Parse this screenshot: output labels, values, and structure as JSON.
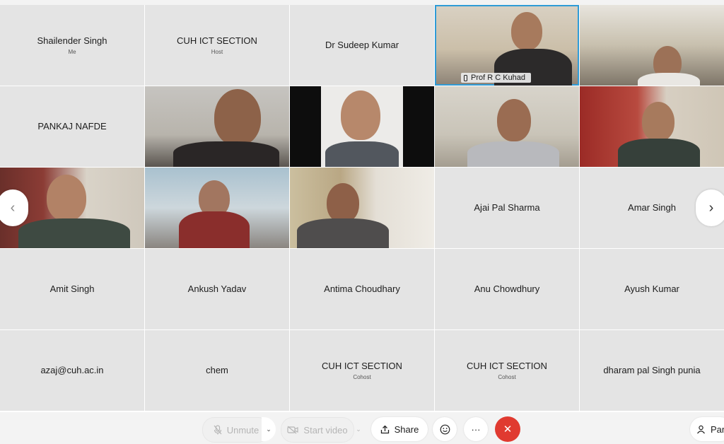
{
  "tiles": [
    {
      "name": "Shailender Singh",
      "role": "Me",
      "type": "name"
    },
    {
      "name": "CUH ICT SECTION",
      "role": "Host",
      "type": "name"
    },
    {
      "name": "Dr Sudeep Kumar",
      "role": "",
      "type": "name"
    },
    {
      "name": "Prof R C Kuhad",
      "role": "",
      "type": "video",
      "speaking": true
    },
    {
      "name": "",
      "role": "",
      "type": "video"
    },
    {
      "name": "PANKAJ NAFDE",
      "role": "",
      "type": "name"
    },
    {
      "name": "",
      "role": "",
      "type": "video"
    },
    {
      "name": "",
      "role": "",
      "type": "video"
    },
    {
      "name": "",
      "role": "",
      "type": "video"
    },
    {
      "name": "",
      "role": "",
      "type": "video"
    },
    {
      "name": "",
      "role": "",
      "type": "video"
    },
    {
      "name": "",
      "role": "",
      "type": "video"
    },
    {
      "name": "",
      "role": "",
      "type": "video"
    },
    {
      "name": "Ajai Pal Sharma",
      "role": "",
      "type": "name"
    },
    {
      "name": "Amar Singh",
      "role": "",
      "type": "name"
    },
    {
      "name": "Amit Singh",
      "role": "",
      "type": "name"
    },
    {
      "name": "Ankush Yadav",
      "role": "",
      "type": "name"
    },
    {
      "name": "Antima Choudhary",
      "role": "",
      "type": "name"
    },
    {
      "name": "Anu Chowdhury",
      "role": "",
      "type": "name"
    },
    {
      "name": "Ayush Kumar",
      "role": "",
      "type": "name"
    },
    {
      "name": "azaj@cuh.ac.in",
      "role": "",
      "type": "name"
    },
    {
      "name": "chem",
      "role": "",
      "type": "name"
    },
    {
      "name": "CUH ICT SECTION",
      "role": "Cohost",
      "type": "name"
    },
    {
      "name": "CUH ICT SECTION",
      "role": "Cohost",
      "type": "name"
    },
    {
      "name": "dharam pal Singh punia",
      "role": "",
      "type": "name"
    }
  ],
  "speaker_label": "Prof R C Kuhad",
  "nav": {
    "prev": "‹",
    "next": "›"
  },
  "controls": {
    "unmute": "Unmute",
    "start_video": "Start video",
    "share": "Share",
    "more": "···",
    "end": "✕",
    "participants": "Part",
    "chevron": "⌄"
  },
  "colors": {
    "accent": "#2f9bd6",
    "end": "#e03a30",
    "tile": "#e4e4e4"
  },
  "icons": [
    "microphone-muted-icon",
    "camera-off-icon",
    "share-icon",
    "emoji-icon",
    "more-icon",
    "end-call-icon",
    "participants-icon",
    "phone-icon",
    "chevron-left-icon",
    "chevron-right-icon"
  ]
}
